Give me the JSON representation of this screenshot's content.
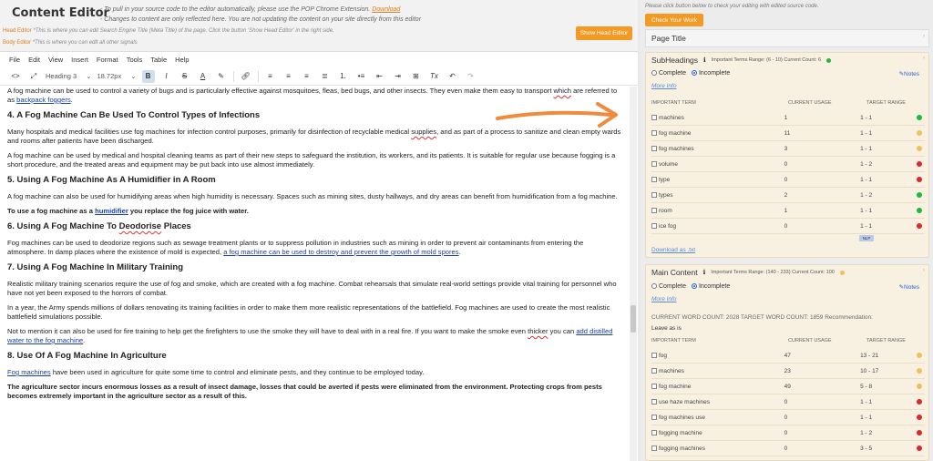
{
  "app": {
    "title": "Content Editor",
    "note1_prefix": "- To pull in your source code to the editor automatically, please use the POP Chrome Extension.",
    "note1_link": "Download",
    "note2": "- Changes to content are only reflected here. You are not updating the content on your site directly from this editor",
    "head_editor_label": "Head Editor",
    "head_editor_hint": "*This is where you can edit Search Engine Title (Meta Title) of the page. Click the button 'Show Head Editor' in the right side.",
    "body_editor_label": "Body Editor",
    "body_editor_hint": "*This is where you can edit all other signals",
    "show_head_button": "Show Head Editor"
  },
  "menubar": [
    "File",
    "Edit",
    "View",
    "Insert",
    "Format",
    "Tools",
    "Table",
    "Help"
  ],
  "toolbar": {
    "block_format": "Heading 3",
    "font_size": "18.72px"
  },
  "doc": {
    "p1_a": "A fog machine can be used to control a variety of bugs and is particularly effective against mosquitoes, fleas, bed bugs, and other insects. They even make them easy to transport ",
    "p1_b": "which",
    "p1_c": " are referred to as ",
    "p1_link": "backpack foggers",
    "p1_d": ".",
    "h4": "4. A Fog Machine Can Be Used To Control Types of Infections",
    "p2_a": "Many hospitals and medical facilities use fog machines for infection control purposes, primarily for disinfection of recyclable medical ",
    "p2_b": "supplies",
    "p2_c": ", and as part of a process to sanitize and clean empty wards and rooms after patients have been discharged.",
    "p3": "A fog machine can be used by medical and hospital cleaning teams as part of their new steps to safeguard the institution, its workers, and its patients. It is suitable for regular use because fogging is a short procedure, and the treated areas and equipment may be put back into use almost immediately.",
    "h5": "5. Using A Fog Machine As A Humidifier in A Room",
    "p4": "A fog machine can also be used for humidifying areas when high humidity is necessary. Spaces such as mining sites, dusty hallways, and dry areas can benefit from humidification from a fog machine.",
    "p5_a": "To use a fog machine as a ",
    "p5_link": "humidifier",
    "p5_b": " you replace the fog juice with water.",
    "h6_a": "6. Using A Fog Machine To ",
    "h6_b": "Deodorise",
    "h6_c": " Places",
    "p6_a": "Fog machines can be used to deodorize regions such as sewage treatment plants or to suppress pollution in industries such as mining in order to prevent air contaminants from entering the atmosphere. In damp places where the existence of mold is expected, ",
    "p6_link": "a fog machine can be used to destroy and prevent the growth of mold spores",
    "p6_b": ".",
    "h7": "7. Using A Fog Machine In Military Training",
    "p7": "Realistic military training scenarios require the use of fog and smoke, which are created with a fog machine. Combat rehearsals that simulate real-world settings provide vital training for personnel who have not yet been exposed to the horrors of combat.",
    "p8": "In a year, the Army spends millions of dollars renovating its training facilities in order to make them more realistic representations of the battlefield. Fog machines are used to create the most realistic battlefield simulations possible.",
    "p9_a": "Not to mention it can also be used for fire training to help get the firefighters to use the smoke they will have to deal with in a real fire. If you want to make the smoke even ",
    "p9_b": "thicker",
    "p9_c": " you can ",
    "p9_link": "add distilled water to the fog machine",
    "p9_d": ".",
    "h8": "8. Use  Of A Fog Machine In Agriculture",
    "p10_link": "Fog machines",
    "p10_b": " have been used in agriculture for quite some time to control and eliminate pests, and they continue to be employed today.",
    "p11": "The agriculture sector incurs enormous losses as a result of insect damage, losses that could be averted if pests were eliminated from the environment. Protecting crops from pests becomes extremely important in the agriculture sector as a result of this."
  },
  "right": {
    "hint": "Please click button below to check your editing with edited source code.",
    "check_button": "Check Your Work",
    "page_title": "Page Title",
    "subheadings": {
      "title": "SubHeadings",
      "meta": "Important Terms Range: (6 - 10) Current Count: 6",
      "complete": "Complete",
      "incomplete": "Incomplete",
      "notes": "Notes",
      "more_info": "More Info",
      "col_term": "IMPORTANT TERM",
      "col_usage": "CURRENT USAGE",
      "col_range": "TARGET RANGE",
      "rows": [
        {
          "term": "machines",
          "usage": "1",
          "range": "1 - 1",
          "status": "green"
        },
        {
          "term": "fog machine",
          "usage": "11",
          "range": "1 - 1",
          "status": "yellow"
        },
        {
          "term": "fog machines",
          "usage": "3",
          "range": "1 - 1",
          "status": "yellow"
        },
        {
          "term": "volume",
          "usage": "0",
          "range": "1 - 2",
          "status": "red"
        },
        {
          "term": "type",
          "usage": "0",
          "range": "1 - 1",
          "status": "red"
        },
        {
          "term": "types",
          "usage": "2",
          "range": "1 - 2",
          "status": "green"
        },
        {
          "term": "room",
          "usage": "1",
          "range": "1 - 1",
          "status": "green"
        },
        {
          "term": "ice fog",
          "usage": "0",
          "range": "1 - 1",
          "status": "red"
        }
      ],
      "nlp": "NLP",
      "download": "Download as .txt"
    },
    "main_content": {
      "title": "Main Content",
      "meta": "Important Terms Range: (140 - 233) Current Count: 100",
      "complete": "Complete",
      "incomplete": "Incomplete",
      "notes": "Notes",
      "more_info": "More Info",
      "word_count": "CURRENT WORD COUNT: 2028   TARGET WORD COUNT: 1859   Recommendation:",
      "leave": "Leave as is",
      "col_term": "IMPORTANT TERM",
      "col_usage": "CURRENT USAGE",
      "col_range": "TARGET RANGE",
      "rows": [
        {
          "term": "fog",
          "usage": "47",
          "range": "13 - 21",
          "status": "yellow"
        },
        {
          "term": "machines",
          "usage": "23",
          "range": "10 - 17",
          "status": "yellow"
        },
        {
          "term": "fog machine",
          "usage": "49",
          "range": "5 - 8",
          "status": "yellow"
        },
        {
          "term": "use haze machines",
          "usage": "0",
          "range": "1 - 1",
          "status": "red"
        },
        {
          "term": "fog machines use",
          "usage": "0",
          "range": "1 - 1",
          "status": "red"
        },
        {
          "term": "fogging machine",
          "usage": "0",
          "range": "1 - 2",
          "status": "red"
        },
        {
          "term": "fogging machines",
          "usage": "0",
          "range": "3 - 5",
          "status": "red"
        }
      ]
    }
  },
  "colors": {
    "accent": "#f39a25",
    "green": "#22b83a",
    "yellow": "#f0c060",
    "red": "#d62b2b",
    "arrow": "#f08a3c"
  }
}
